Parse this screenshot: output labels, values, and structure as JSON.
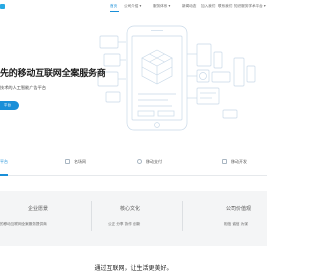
{
  "nav": {
    "items": [
      {
        "label": "首页",
        "active": true
      },
      {
        "label": "公司介绍 ▾",
        "active": false
      },
      {
        "label": "服务体系 ▾",
        "active": false
      },
      {
        "label": "新闻动态",
        "active": false
      },
      {
        "label": "加入我们",
        "active": false
      },
      {
        "label": "联系我们",
        "active": false
      },
      {
        "label": "知识服务学术平台 ▾",
        "active": false
      }
    ]
  },
  "hero": {
    "title": "先的移动互联网全案服务商",
    "subtitle": "技术的人工智能广告平台",
    "button_label": "平台"
  },
  "tabs": {
    "items": [
      {
        "label": "平台",
        "icon": "platform-icon",
        "active": true
      },
      {
        "label": "名场网",
        "icon": "mobile-icon",
        "active": false
      },
      {
        "label": "移动支付",
        "icon": "payment-icon",
        "active": false
      },
      {
        "label": "移动开发",
        "icon": "develop-icon",
        "active": false
      }
    ]
  },
  "values": {
    "vision": {
      "title": "企业愿景",
      "desc": "的移动互联网全案服务提供商"
    },
    "culture": {
      "title": "核心文化",
      "desc": "公正  分享  协作  创新"
    },
    "value": {
      "title": "公司价值观",
      "desc": "相信  诚信  为谋"
    }
  },
  "slogan": "通过互联网，让生活更美好。",
  "colors": {
    "accent": "#1a8fd8",
    "band_bg": "#f4f5f6",
    "line_art": "#c9d9e8"
  }
}
